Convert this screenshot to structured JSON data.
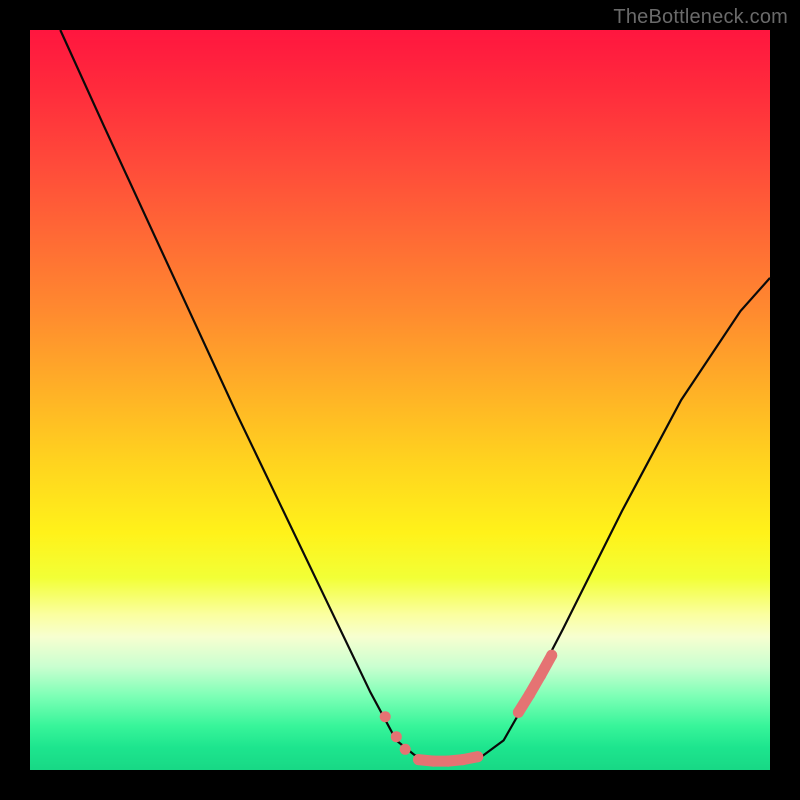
{
  "watermark": "TheBottleneck.com",
  "colors": {
    "background": "#000000",
    "curve": "#0a0a0a",
    "marker_fill": "#e57373",
    "marker_stroke": "#d46767",
    "gradient_top": "#ff163f",
    "gradient_bottom": "#18d885"
  },
  "chart_data": {
    "type": "line",
    "title": "",
    "xlabel": "",
    "ylabel": "",
    "xlim": [
      0,
      1
    ],
    "ylim": [
      0,
      1
    ],
    "annotations": [
      "TheBottleneck.com"
    ],
    "series": [
      {
        "name": "curve",
        "description": "V-shaped curve; steep descent from top-left, flat trough near bottom-center, moderate rise toward upper-right",
        "x": [
          0.041,
          0.1,
          0.16,
          0.22,
          0.28,
          0.34,
          0.4,
          0.46,
          0.495,
          0.52,
          0.55,
          0.58,
          0.61,
          0.64,
          0.66,
          0.72,
          0.8,
          0.88,
          0.96,
          1.0
        ],
        "y": [
          1.0,
          0.87,
          0.74,
          0.61,
          0.48,
          0.355,
          0.23,
          0.105,
          0.04,
          0.02,
          0.012,
          0.012,
          0.018,
          0.04,
          0.075,
          0.19,
          0.35,
          0.5,
          0.62,
          0.665
        ]
      },
      {
        "name": "left-markers",
        "type": "scatter",
        "x": [
          0.48,
          0.495,
          0.507
        ],
        "y": [
          0.072,
          0.045,
          0.028
        ]
      },
      {
        "name": "trough-markers",
        "type": "scatter-line",
        "x": [
          0.525,
          0.545,
          0.565,
          0.585,
          0.605
        ],
        "y": [
          0.014,
          0.012,
          0.012,
          0.014,
          0.018
        ]
      },
      {
        "name": "right-markers",
        "type": "scatter-line",
        "x": [
          0.66,
          0.675,
          0.69,
          0.705
        ],
        "y": [
          0.078,
          0.102,
          0.128,
          0.155
        ]
      }
    ]
  }
}
